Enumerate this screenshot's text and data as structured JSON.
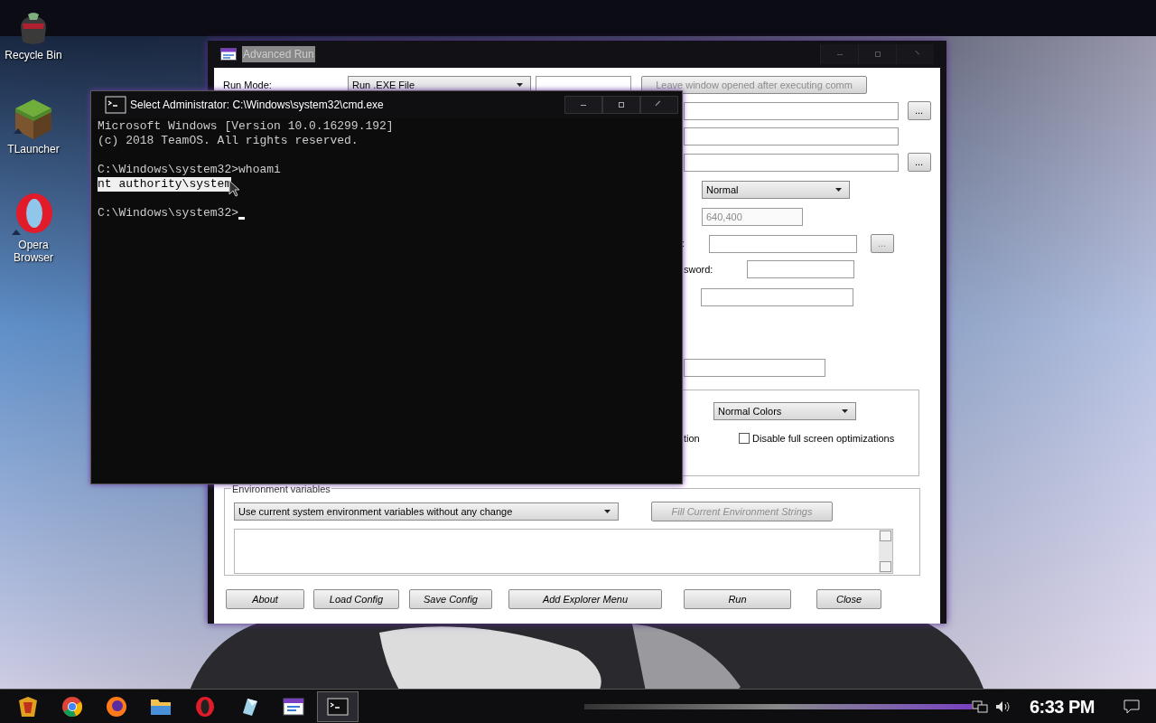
{
  "desktop_icons": [
    {
      "kind": "bin",
      "label": "Recycle Bin"
    },
    {
      "kind": "block",
      "label": "TLauncher"
    },
    {
      "kind": "ring",
      "label": "Opera Browser"
    }
  ],
  "advanced_run": {
    "title": "Advanced Run",
    "run_mode": {
      "label": "Run Mode:",
      "value": "Run .EXE File"
    },
    "leave_open_button": {
      "label": "Leave window opened after executing comm",
      "disabled": true
    },
    "browse_buttons": [
      {
        "label": "...",
        "disabled": false
      },
      {
        "label": "...",
        "disabled": false
      },
      {
        "label": "...",
        "disabled": true
      }
    ],
    "window_state": {
      "value": "Normal"
    },
    "window_size": {
      "value": "640,400",
      "disabled": true
    },
    "labels": [
      ":",
      "sword:",
      "tion"
    ],
    "color_mode": {
      "value": "Normal Colors"
    },
    "disable_fullscreen": {
      "label": "Disable full screen optimizations",
      "checked": false
    },
    "environment": {
      "legend": "Environment variables",
      "mode": "Use current system environment variables without any change",
      "fill_button": {
        "label": "Fill Current Environment Strings",
        "disabled": true
      }
    },
    "buttons": [
      "About",
      "Load Config",
      "Save Config",
      "Add Explorer Menu",
      "Run",
      "Close"
    ]
  },
  "console": {
    "title": "Select Administrator: C:\\Windows\\system32\\cmd.exe",
    "cursor": true,
    "lines": [
      {
        "text": "Microsoft Windows [Version 10.0.16299.192]",
        "selected": false
      },
      {
        "text": "(c) 2018 TeamOS. All rights reserved.",
        "selected": false
      },
      {
        "kind": "blank"
      },
      {
        "text": "C:\\Windows\\system32>whoami",
        "selected": false
      },
      {
        "text": "nt authority\\system",
        "selected": true
      },
      {
        "kind": "blank"
      },
      {
        "text": "C:\\Windows\\system32>",
        "selected": false
      }
    ]
  },
  "taskbar": {
    "apps": [
      {
        "kind": "start",
        "selected": false
      },
      {
        "kind": "chrome",
        "selected": false
      },
      {
        "kind": "firefox",
        "selected": false
      },
      {
        "kind": "folder",
        "selected": false
      },
      {
        "kind": "opera",
        "selected": false
      },
      {
        "kind": "crystal",
        "selected": false
      },
      {
        "kind": "advrun",
        "selected": false
      },
      {
        "kind": "cmd",
        "selected": true
      }
    ],
    "clock": "6:33 PM"
  }
}
